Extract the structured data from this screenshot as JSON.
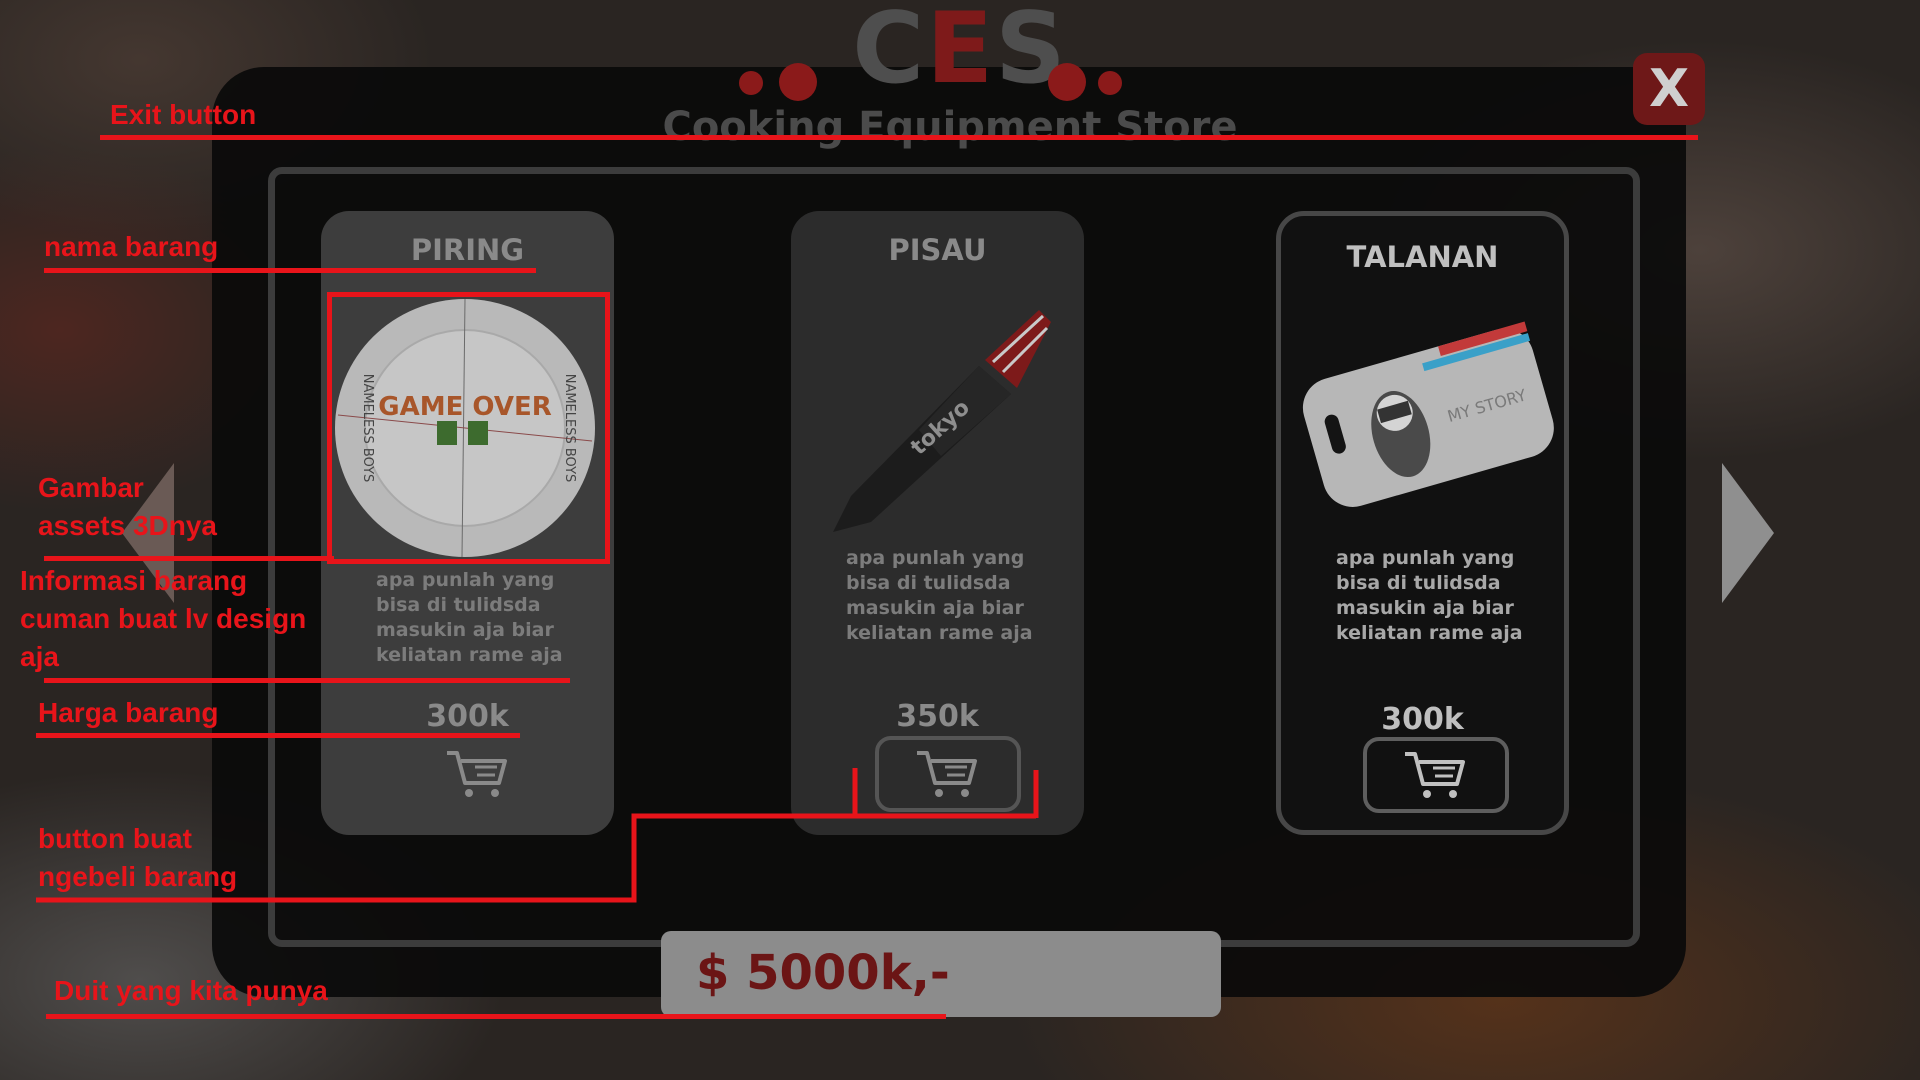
{
  "store": {
    "logo_prefix": "C",
    "logo_accent": "E",
    "logo_suffix": "S",
    "subtitle": "Cooking Equipment Store",
    "exit_label": "X"
  },
  "items": [
    {
      "name": "PIRING",
      "image_icon": "plate-3d-icon",
      "image_text": "GAME OVER",
      "image_side_text": "NAMELESS BOYS",
      "description": [
        "apa punlah yang",
        "bisa di tulidsda",
        "masukin aja biar",
        "keliatan rame aja"
      ],
      "price": "300k",
      "cart_icon": "cart-icon"
    },
    {
      "name": "PISAU",
      "image_icon": "knife-3d-icon",
      "description": [
        "apa punlah yang",
        "bisa di tulidsda",
        "masukin aja biar",
        "keliatan rame aja"
      ],
      "price": "350k",
      "cart_icon": "cart-icon"
    },
    {
      "name": "TALANAN",
      "image_icon": "cutting-board-3d-icon",
      "image_text": "MY STORY",
      "description": [
        "apa punlah yang",
        "bisa di tulidsda",
        "masukin aja biar",
        "keliatan rame aja"
      ],
      "price": "300k",
      "cart_icon": "cart-icon"
    }
  ],
  "wallet": {
    "amount": "$ 5000k,-"
  },
  "nav": {
    "prev_icon": "arrow-left-icon",
    "next_icon": "arrow-right-icon"
  },
  "annotations": {
    "exit": "Exit button",
    "name": "nama barang",
    "image_line1": "Gambar",
    "image_line2": "assets 3Dnya",
    "info_line1": "Informasi barang",
    "info_line2": "cuman buat lv design",
    "info_line3": "aja",
    "price": "Harga barang",
    "buy_line1": "button buat",
    "buy_line2": "ngebeli barang",
    "money": "Duit yang kita punya"
  },
  "colors": {
    "accent_red": "#7e1a1a",
    "annotation_red": "#e8141a",
    "panel_bg": "#0a0a0a"
  }
}
